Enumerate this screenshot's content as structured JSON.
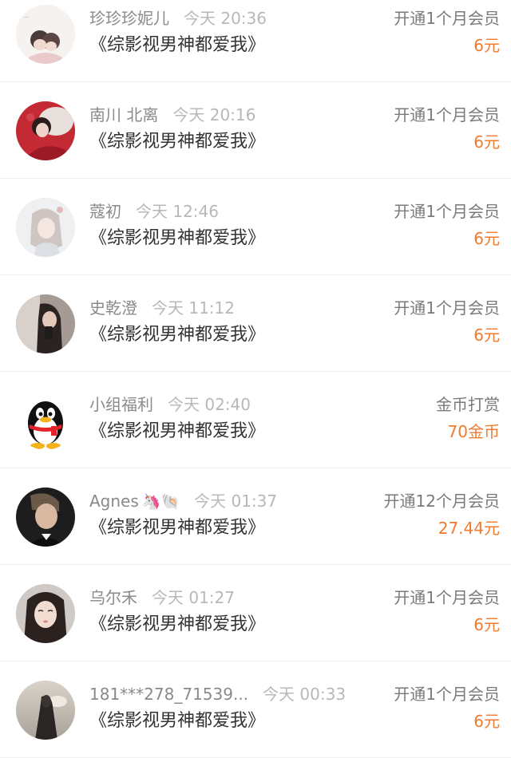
{
  "colors": {
    "name": "#8a8a8a",
    "time": "#b8b8b8",
    "book": "#333333",
    "action": "#7a7a7a",
    "price": "#f07a2d",
    "divider": "#f0f0f0"
  },
  "items": [
    {
      "avatar_icon": "anime-couple-avatar",
      "name": "珍珍珍妮儿",
      "emoji": "",
      "time": "今天 20:36",
      "book": "《综影视男神都爱我》",
      "action": "开通1个月会员",
      "price": "6元"
    },
    {
      "avatar_icon": "red-costume-avatar",
      "name": "南川 北离",
      "emoji": "",
      "time": "今天 20:16",
      "book": "《综影视男神都爱我》",
      "action": "开通1个月会员",
      "price": "6元"
    },
    {
      "avatar_icon": "anime-girl-avatar",
      "name": "蔻初",
      "emoji": "",
      "time": "今天 12:46",
      "book": "《综影视男神都爱我》",
      "action": "开通1个月会员",
      "price": "6元"
    },
    {
      "avatar_icon": "selfie-girl-avatar",
      "name": "史乾澄",
      "emoji": "",
      "time": "今天 11:12",
      "book": "《综影视男神都爱我》",
      "action": "开通1个月会员",
      "price": "6元"
    },
    {
      "avatar_icon": "qq-penguin-avatar",
      "name": "小组福利",
      "emoji": "",
      "time": "今天 02:40",
      "book": "《综影视男神都爱我》",
      "action": "金币打赏",
      "price": "70金币"
    },
    {
      "avatar_icon": "man-portrait-avatar",
      "name": "Agnes",
      "emoji": "🦄🐚",
      "time": "今天 01:37",
      "book": "《综影视男神都爱我》",
      "action": "开通12个月会员",
      "price": "27.44元"
    },
    {
      "avatar_icon": "girl-portrait-avatar",
      "name": "乌尔禾",
      "emoji": "",
      "time": "今天 01:27",
      "book": "《综影视男神都爱我》",
      "action": "开通1个月会员",
      "price": "6元"
    },
    {
      "avatar_icon": "silhouette-avatar",
      "name": "181***278_71539...",
      "emoji": "",
      "time": "今天 00:33",
      "book": "《综影视男神都爱我》",
      "action": "开通1个月会员",
      "price": "6元"
    }
  ]
}
